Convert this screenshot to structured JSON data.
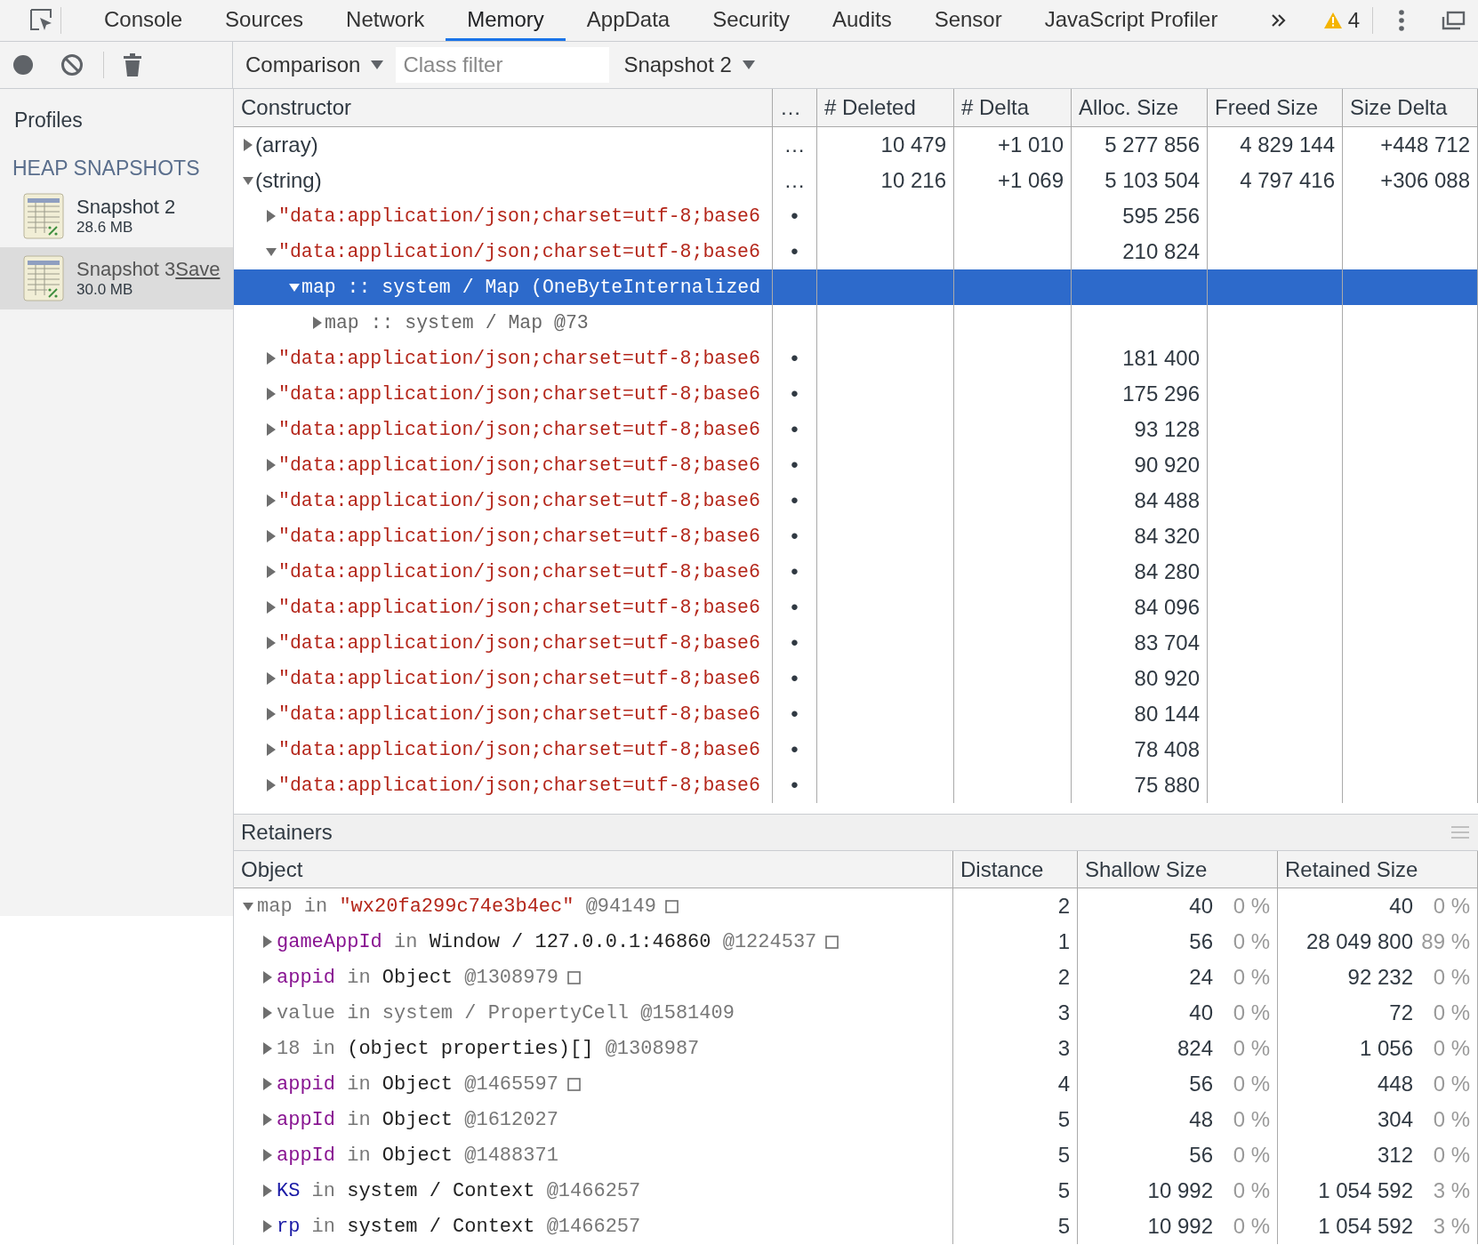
{
  "tabs": [
    {
      "label": "Console",
      "selected": false
    },
    {
      "label": "Sources",
      "selected": false
    },
    {
      "label": "Network",
      "selected": false
    },
    {
      "label": "Memory",
      "selected": true
    },
    {
      "label": "AppData",
      "selected": false
    },
    {
      "label": "Security",
      "selected": false
    },
    {
      "label": "Audits",
      "selected": false
    },
    {
      "label": "Sensor",
      "selected": false
    },
    {
      "label": "JavaScript Profiler",
      "selected": false
    }
  ],
  "warning_count": "4",
  "toolbar": {
    "view": "Comparison",
    "filter_placeholder": "Class filter",
    "base_snapshot": "Snapshot 2"
  },
  "sidebar": {
    "title": "Profiles",
    "section": "HEAP SNAPSHOTS",
    "items": [
      {
        "title": "Snapshot 2",
        "size": "28.6 MB",
        "selected": false
      },
      {
        "title": "Snapshot 3",
        "size": "30.0 MB",
        "link": "Save",
        "selected": true
      }
    ]
  },
  "constructors": {
    "columns": [
      "Constructor",
      "…",
      "# Deleted",
      "# Delta",
      "Alloc. Size",
      "Freed Size",
      "Size Delta"
    ],
    "rows": [
      {
        "label": "(array)",
        "kind": "group",
        "distance": "…",
        "deleted": "10 479",
        "delta": "+1 010",
        "alloc_size": "5 277 856",
        "freed_size": "4 829 144",
        "size_delta": "+448 712",
        "expanded": false,
        "selected": false
      },
      {
        "label": "(string)",
        "kind": "group",
        "distance": "…",
        "deleted": "10 216",
        "delta": "+1 069",
        "alloc_size": "5 103 504",
        "freed_size": "4 797 416",
        "size_delta": "+306 088",
        "expanded": true,
        "selected": false,
        "children": [
          {
            "label": "\"data:application/json;charset=utf-8;base6",
            "kind": "string",
            "distance": "•",
            "alloc_size": "595 256",
            "expanded": false,
            "selected": false
          },
          {
            "label": "\"data:application/json;charset=utf-8;base6",
            "kind": "string",
            "distance": "•",
            "alloc_size": "210 824",
            "expanded": true,
            "selected": false,
            "children": [
              {
                "label": "map :: system / Map (OneByteInternalized",
                "kind": "object",
                "expanded": true,
                "selected": true,
                "children": [
                  {
                    "label": "map :: system / Map @73",
                    "kind": "object",
                    "expanded": false,
                    "selected": false
                  }
                ]
              }
            ]
          },
          {
            "label": "\"data:application/json;charset=utf-8;base6",
            "kind": "string",
            "distance": "•",
            "alloc_size": "181 400",
            "expanded": false,
            "selected": false
          },
          {
            "label": "\"data:application/json;charset=utf-8;base6",
            "kind": "string",
            "distance": "•",
            "alloc_size": "175 296",
            "expanded": false,
            "selected": false
          },
          {
            "label": "\"data:application/json;charset=utf-8;base6",
            "kind": "string",
            "distance": "•",
            "alloc_size": "93 128",
            "expanded": false,
            "selected": false
          },
          {
            "label": "\"data:application/json;charset=utf-8;base6",
            "kind": "string",
            "distance": "•",
            "alloc_size": "90 920",
            "expanded": false,
            "selected": false
          },
          {
            "label": "\"data:application/json;charset=utf-8;base6",
            "kind": "string",
            "distance": "•",
            "alloc_size": "84 488",
            "expanded": false,
            "selected": false
          },
          {
            "label": "\"data:application/json;charset=utf-8;base6",
            "kind": "string",
            "distance": "•",
            "alloc_size": "84 320",
            "expanded": false,
            "selected": false
          },
          {
            "label": "\"data:application/json;charset=utf-8;base6",
            "kind": "string",
            "distance": "•",
            "alloc_size": "84 280",
            "expanded": false,
            "selected": false
          },
          {
            "label": "\"data:application/json;charset=utf-8;base6",
            "kind": "string",
            "distance": "•",
            "alloc_size": "84 096",
            "expanded": false,
            "selected": false
          },
          {
            "label": "\"data:application/json;charset=utf-8;base6",
            "kind": "string",
            "distance": "•",
            "alloc_size": "83 704",
            "expanded": false,
            "selected": false
          },
          {
            "label": "\"data:application/json;charset=utf-8;base6",
            "kind": "string",
            "distance": "•",
            "alloc_size": "80 920",
            "expanded": false,
            "selected": false
          },
          {
            "label": "\"data:application/json;charset=utf-8;base6",
            "kind": "string",
            "distance": "•",
            "alloc_size": "80 144",
            "expanded": false,
            "selected": false
          },
          {
            "label": "\"data:application/json;charset=utf-8;base6",
            "kind": "string",
            "distance": "•",
            "alloc_size": "78 408",
            "expanded": false,
            "selected": false
          },
          {
            "label": "\"data:application/json;charset=utf-8;base6",
            "kind": "string",
            "distance": "•",
            "alloc_size": "75 880",
            "expanded": false,
            "selected": false
          }
        ]
      }
    ]
  },
  "retainers": {
    "title": "Retainers",
    "columns": [
      "Object",
      "Distance",
      "Shallow Size",
      "Retained Size"
    ],
    "rows": [
      {
        "name": "map",
        "kind": "self",
        "connector": "in",
        "owner": "\"wx20fa299c74e3b4ec\"",
        "id": "@94149",
        "boxed": true,
        "expanded": true,
        "distance": "2",
        "shallow": "40",
        "shallow_pct": "0 %",
        "retained": "40",
        "retained_pct": "0 %",
        "children": [
          {
            "name": "gameAppId",
            "kind": "property",
            "connector": "in",
            "owner": "Window / 127.0.0.1:46860",
            "id": "@1224537",
            "boxed": true,
            "expanded": false,
            "distance": "1",
            "shallow": "56",
            "shallow_pct": "0 %",
            "retained": "28 049 800",
            "retained_pct": "89 %"
          },
          {
            "name": "appid",
            "kind": "property",
            "connector": "in",
            "owner": "Object",
            "id": "@1308979",
            "boxed": true,
            "expanded": false,
            "distance": "2",
            "shallow": "24",
            "shallow_pct": "0 %",
            "retained": "92 232",
            "retained_pct": "0 %"
          },
          {
            "name": "value",
            "kind": "internal",
            "connector": "in",
            "owner": "system / PropertyCell",
            "id": "@1581409",
            "boxed": false,
            "expanded": false,
            "distance": "3",
            "shallow": "40",
            "shallow_pct": "0 %",
            "retained": "72",
            "retained_pct": "0 %"
          },
          {
            "name": "18",
            "kind": "element",
            "connector": "in",
            "owner": "(object properties)[]",
            "id": "@1308987",
            "boxed": false,
            "expanded": false,
            "distance": "3",
            "shallow": "824",
            "shallow_pct": "0 %",
            "retained": "1 056",
            "retained_pct": "0 %"
          },
          {
            "name": "appid",
            "kind": "property",
            "connector": "in",
            "owner": "Object",
            "id": "@1465597",
            "boxed": true,
            "expanded": false,
            "distance": "4",
            "shallow": "56",
            "shallow_pct": "0 %",
            "retained": "448",
            "retained_pct": "0 %"
          },
          {
            "name": "appId",
            "kind": "property",
            "connector": "in",
            "owner": "Object",
            "id": "@1612027",
            "boxed": false,
            "expanded": false,
            "distance": "5",
            "shallow": "48",
            "shallow_pct": "0 %",
            "retained": "304",
            "retained_pct": "0 %"
          },
          {
            "name": "appId",
            "kind": "property",
            "connector": "in",
            "owner": "Object",
            "id": "@1488371",
            "boxed": false,
            "expanded": false,
            "distance": "5",
            "shallow": "56",
            "shallow_pct": "0 %",
            "retained": "312",
            "retained_pct": "0 %"
          },
          {
            "name": "KS",
            "kind": "context",
            "connector": "in",
            "owner": "system / Context",
            "id": "@1466257",
            "boxed": false,
            "expanded": false,
            "distance": "5",
            "shallow": "10 992",
            "shallow_pct": "0 %",
            "retained": "1 054 592",
            "retained_pct": "3 %"
          },
          {
            "name": "rp",
            "kind": "context",
            "connector": "in",
            "owner": "system / Context",
            "id": "@1466257",
            "boxed": false,
            "expanded": false,
            "distance": "5",
            "shallow": "10 992",
            "shallow_pct": "0 %",
            "retained": "1 054 592",
            "retained_pct": "3 %"
          }
        ]
      }
    ]
  }
}
